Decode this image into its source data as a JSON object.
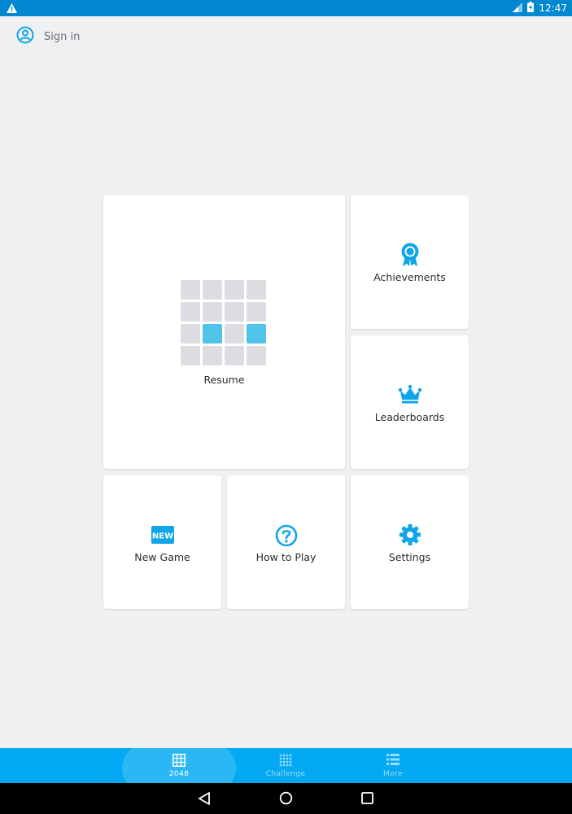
{
  "status_bar": {
    "time": "12:47",
    "icons": [
      "warning-icon",
      "signal-icon",
      "battery-charging-icon"
    ]
  },
  "account": {
    "sign_in_label": "Sign in",
    "icon": "account-circle-icon"
  },
  "tiles": {
    "resume": {
      "label": "Resume",
      "board": [
        [
          0,
          0,
          0,
          0
        ],
        [
          0,
          0,
          0,
          0
        ],
        [
          0,
          1,
          0,
          1
        ],
        [
          0,
          0,
          0,
          0
        ]
      ]
    },
    "achievements": {
      "label": "Achievements",
      "icon": "award-ribbon-icon"
    },
    "leaderboards": {
      "label": "Leaderboards",
      "icon": "crown-icon"
    },
    "new_game": {
      "label": "New Game",
      "icon": "new-badge-icon",
      "badge_text": "NEW"
    },
    "how_to_play": {
      "label": "How to Play",
      "icon": "help-circle-icon"
    },
    "settings": {
      "label": "Settings",
      "icon": "gear-icon"
    }
  },
  "bottom_nav": {
    "items": [
      {
        "label": "2048",
        "icon": "grid-icon",
        "active": true
      },
      {
        "label": "Challenge",
        "icon": "dots-grid-icon",
        "active": false
      },
      {
        "label": "More",
        "icon": "list-icon",
        "active": false
      }
    ]
  },
  "system_nav": {
    "buttons": [
      "back-icon",
      "home-icon",
      "recents-icon"
    ]
  },
  "colors": {
    "accent": "#03a9f4",
    "status_bar": "#0288d1",
    "icon_blue": "#0ea5e9",
    "tile_on": "#4fc3e8",
    "tile_off": "#dcdde0",
    "background": "#eff0f2"
  }
}
